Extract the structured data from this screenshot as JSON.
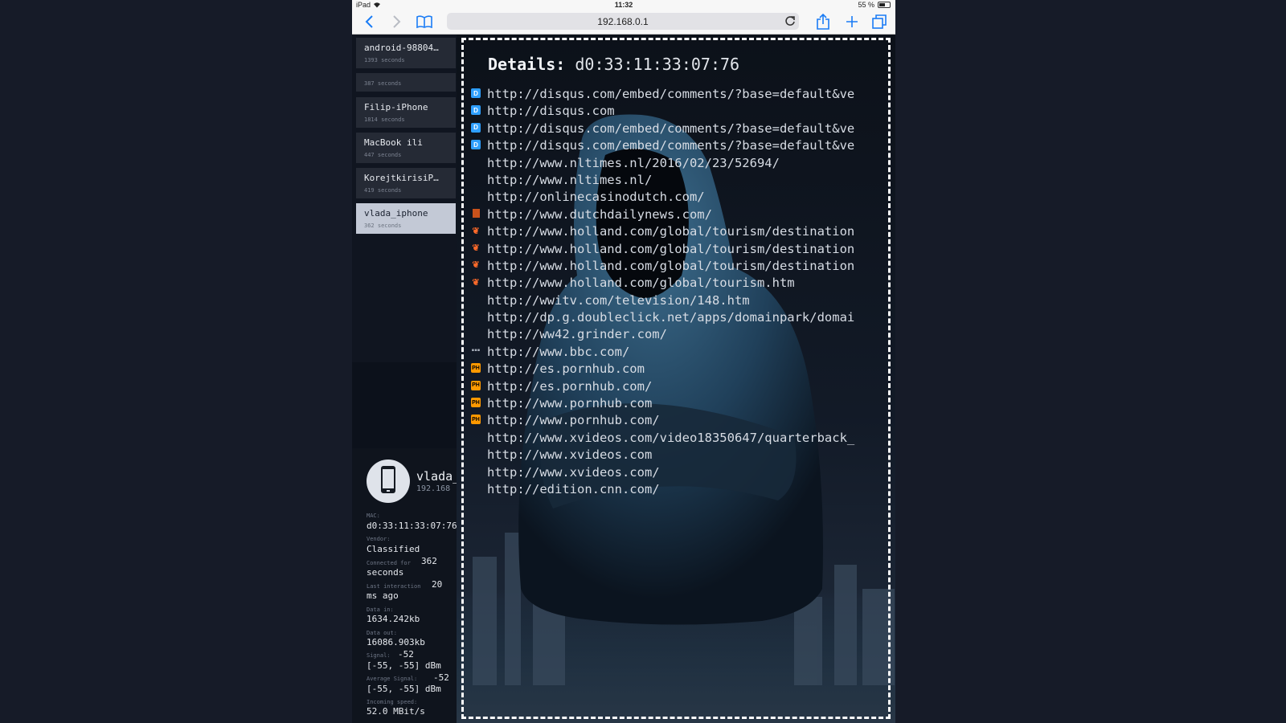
{
  "status_bar": {
    "device": "iPad",
    "time": "11:32",
    "battery": "55 %",
    "battery_level": 0.55
  },
  "browser": {
    "url": "192.168.0.1"
  },
  "devices": [
    {
      "name": "android-98804…",
      "time": "1393 seconds",
      "selected": false
    },
    {
      "name": "",
      "time": "387 seconds",
      "selected": false
    },
    {
      "name": "Filip-iPhone",
      "time": "1814 seconds",
      "selected": false
    },
    {
      "name": "MacBook ili",
      "time": "447 seconds",
      "selected": false
    },
    {
      "name": "KorejtkirisiP…",
      "time": "419 seconds",
      "selected": false
    },
    {
      "name": "vlada_iphone",
      "time": "362 seconds",
      "selected": true
    }
  ],
  "details": {
    "label": "Details:",
    "mac": "d0:33:11:33:07:76",
    "urls": [
      {
        "icon": "disqus-icon",
        "glyph": "D",
        "url": "http://disqus.com/embed/comments/?base=default&ve"
      },
      {
        "icon": "disqus-icon",
        "glyph": "D",
        "url": "http://disqus.com"
      },
      {
        "icon": "disqus-icon",
        "glyph": "D",
        "url": "http://disqus.com/embed/comments/?base=default&ve"
      },
      {
        "icon": "disqus-icon",
        "glyph": "D",
        "url": "http://disqus.com/embed/comments/?base=default&ve"
      },
      {
        "icon": "",
        "glyph": "",
        "url": "http://www.nltimes.nl/2016/02/23/52694/"
      },
      {
        "icon": "",
        "glyph": "",
        "url": "http://www.nltimes.nl/"
      },
      {
        "icon": "",
        "glyph": "",
        "url": "http://onlinecasinodutch.com/"
      },
      {
        "icon": "dutchdailynews-icon",
        "glyph": "",
        "url": "http://www.dutchdailynews.com/"
      },
      {
        "icon": "tulip-icon",
        "glyph": "❦",
        "url": "http://www.holland.com/global/tourism/destination"
      },
      {
        "icon": "tulip-icon",
        "glyph": "❦",
        "url": "http://www.holland.com/global/tourism/destination"
      },
      {
        "icon": "tulip-icon",
        "glyph": "❦",
        "url": "http://www.holland.com/global/tourism/destination"
      },
      {
        "icon": "tulip-icon",
        "glyph": "❦",
        "url": "http://www.holland.com/global/tourism.htm"
      },
      {
        "icon": "",
        "glyph": "",
        "url": "http://wwitv.com/television/148.htm"
      },
      {
        "icon": "",
        "glyph": "",
        "url": "http://dp.g.doubleclick.net/apps/domainpark/domai"
      },
      {
        "icon": "",
        "glyph": "",
        "url": "http://ww42.grinder.com/"
      },
      {
        "icon": "bbc-icon",
        "glyph": "▪▪▪",
        "url": "http://www.bbc.com/"
      },
      {
        "icon": "pornhub-icon",
        "glyph": "PH",
        "url": "http://es.pornhub.com"
      },
      {
        "icon": "pornhub-icon",
        "glyph": "PH",
        "url": "http://es.pornhub.com/"
      },
      {
        "icon": "pornhub-icon",
        "glyph": "PH",
        "url": "http://www.pornhub.com"
      },
      {
        "icon": "pornhub-icon",
        "glyph": "PH",
        "url": "http://www.pornhub.com/"
      },
      {
        "icon": "",
        "glyph": "",
        "url": "http://www.xvideos.com/video18350647/quarterback_"
      },
      {
        "icon": "",
        "glyph": "",
        "url": "http://www.xvideos.com"
      },
      {
        "icon": "",
        "glyph": "",
        "url": "http://www.xvideos.com/"
      },
      {
        "icon": "",
        "glyph": "",
        "url": "http://edition.cnn.com/"
      }
    ]
  },
  "info": {
    "name": "vlada_",
    "ip": "192.168",
    "mac_label": "MAC:",
    "mac": "d0:33:11:33:07:76",
    "vendor_label": "Vendor:",
    "vendor": "Classified",
    "connected_label": "Connected for",
    "connected_value": "362",
    "connected_unit": "seconds",
    "last_label": "Last interaction",
    "last_value": "20",
    "last_unit": "ms ago",
    "data_in_label": "Data in:",
    "data_in": "1634.242kb",
    "data_out_label": "Data out:",
    "data_out": "16086.903kb",
    "signal_label": "Signal:",
    "signal_value": "-52",
    "signal_range": "[-55, -55] dBm",
    "avg_signal_label": "Average Signal:",
    "avg_signal_value": "-52",
    "avg_signal_range": "[-55, -55] dBm",
    "speed_label": "Incoming speed:",
    "speed": "52.0 MBit/s"
  }
}
